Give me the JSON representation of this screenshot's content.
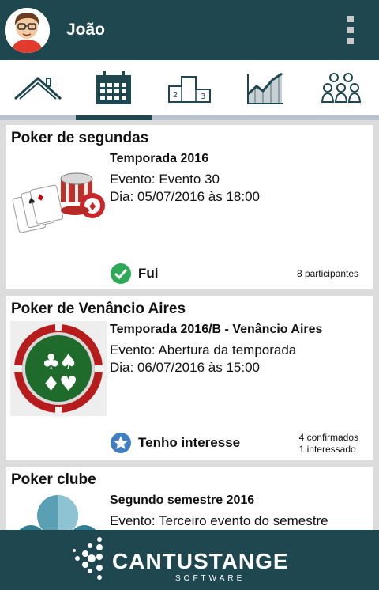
{
  "header": {
    "username": "João",
    "avatar_icon": "avatar-icon",
    "menu_icon": "overflow-menu-icon"
  },
  "tabs": [
    {
      "name": "home",
      "icon": "house-icon",
      "active": false
    },
    {
      "name": "calendar",
      "icon": "calendar-icon",
      "active": true
    },
    {
      "name": "ranking",
      "icon": "podium-icon",
      "active": false
    },
    {
      "name": "stats",
      "icon": "chart-icon",
      "active": false
    },
    {
      "name": "people",
      "icon": "group-icon",
      "active": false
    }
  ],
  "events": [
    {
      "group": "Poker de segundas",
      "season": "Temporada 2016",
      "event": "Evento: Evento 30",
      "date": "Dia: 05/07/2016 às 18:00",
      "status": "Fui",
      "status_icon": "check-circle-icon",
      "meta1": "8 participantes",
      "meta2": ""
    },
    {
      "group": "Poker de Venâncio Aires",
      "season": "Temporada 2016/B - Venâncio Aires",
      "event": "Evento: Abertura da temporada",
      "date": "Dia: 06/07/2016 às 15:00",
      "status": "Tenho interesse",
      "status_icon": "star-circle-icon",
      "meta1": "4 confirmados",
      "meta2": "1 interessado"
    },
    {
      "group": "Poker clube",
      "season": "Segundo semestre 2016",
      "event": "Evento: Terceiro evento do semestre",
      "date": ""
    }
  ],
  "footer": {
    "brand": "CANTUSTANGE",
    "sub": "SOFTWARE"
  },
  "colors": {
    "bar": "#1e4750",
    "check": "#2eaa57",
    "star": "#3f7fc1",
    "tab_underline": "#b9c3cf"
  }
}
